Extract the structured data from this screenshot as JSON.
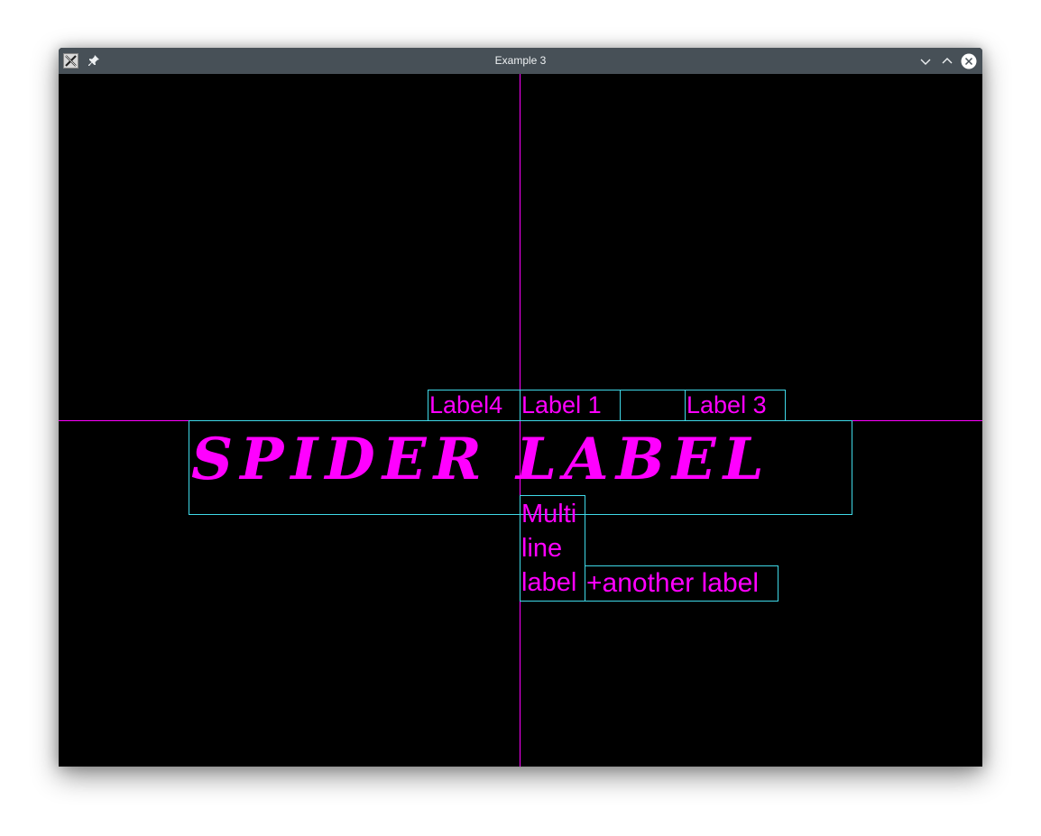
{
  "window": {
    "title": "Example 3",
    "icons": {
      "app": "x-app-icon",
      "pin": "pin-icon",
      "minimize": "chevron-down-icon",
      "maximize": "chevron-up-icon",
      "close": "close-icon"
    }
  },
  "colors": {
    "background": "#000000",
    "label_text": "#ff00ff",
    "label_border": "#3fd9e8",
    "axis": "#ff00ff",
    "titlebar": "#475057"
  },
  "labels": {
    "label4": "Label4",
    "label1": "Label 1",
    "label2": "",
    "label3": "Label 3",
    "spider": "SPIDER LABEL",
    "multiline": "Multi\nline\nlabel",
    "another": "+another label"
  }
}
